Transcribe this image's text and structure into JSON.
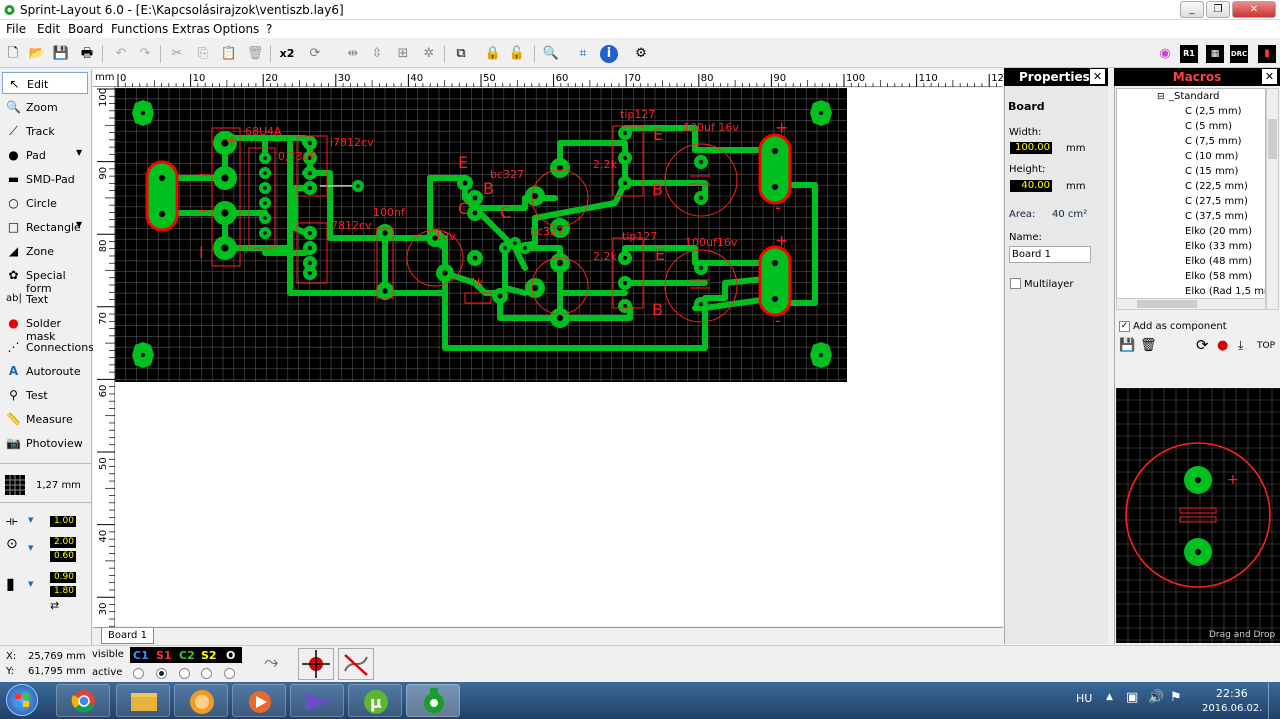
{
  "window": {
    "title": "Sprint-Layout 6.0 - [E:\\Kapcsolásirajzok\\ventiszb.lay6]",
    "buttons": [
      "_",
      "❐",
      "✕"
    ]
  },
  "menu": [
    "File",
    "Edit",
    "Board",
    "Functions",
    "Extras",
    "Options",
    "?"
  ],
  "toolbar": {
    "items": [
      "new-icon",
      "open-icon",
      "save-icon",
      "print-icon",
      "undo-icon",
      "redo-icon",
      "cut-icon",
      "copy-icon",
      "paste-icon",
      "delete-icon",
      "duplicate-icon",
      "rotate-icon",
      "mirror-h-icon",
      "mirror-v-icon",
      "align-icon",
      "group-icon",
      "lock-icon",
      "unlock-icon",
      "zoom-icon",
      "crop-icon",
      "info-icon",
      "gear-icon"
    ],
    "duplicate_label": "x2"
  },
  "tools": [
    {
      "label": "Edit",
      "icon": "arrow-icon"
    },
    {
      "label": "Zoom",
      "icon": "zoom-icon"
    },
    {
      "label": "Track",
      "icon": "track-icon"
    },
    {
      "label": "Pad",
      "icon": "pad-icon"
    },
    {
      "label": "SMD-Pad",
      "icon": "smd-pad-icon"
    },
    {
      "label": "Circle",
      "icon": "circle-icon"
    },
    {
      "label": "Rectangle",
      "icon": "rectangle-icon"
    },
    {
      "label": "Zone",
      "icon": "zone-icon"
    },
    {
      "label": "Special form",
      "icon": "special-form-icon"
    },
    {
      "label": "Text",
      "icon": "text-icon"
    },
    {
      "label": "Solder mask",
      "icon": "solder-mask-icon"
    },
    {
      "label": "Connections",
      "icon": "connections-icon"
    },
    {
      "label": "Autoroute",
      "icon": "autoroute-icon"
    },
    {
      "label": "Test",
      "icon": "test-icon"
    },
    {
      "label": "Measure",
      "icon": "measure-icon"
    },
    {
      "label": "Photoview",
      "icon": "photoview-icon"
    }
  ],
  "grid": "1,27 mm",
  "track_width": "1.00",
  "pad_outer": "2.00",
  "pad_inner": "0.60",
  "smd_w": "0.90",
  "smd_h": "1.80",
  "ruler": {
    "unit": "mm",
    "h_ticks": [
      "0",
      "10",
      "20",
      "30",
      "40",
      "50",
      "60",
      "70",
      "80",
      "90",
      "100",
      "110",
      "120"
    ],
    "v_ticks": [
      "100",
      "90",
      "80",
      "70",
      "60",
      "50",
      "40",
      "30"
    ]
  },
  "board_tab": "Board 1",
  "pcb_labels": [
    "68U4A",
    "0,33uF",
    "i7812cv",
    "i7812cv",
    "100nf",
    "bc327",
    "bc327",
    "tip127",
    "tip127",
    "100uf 16v",
    "100uf16v",
    "2,2k",
    "2,2k",
    "1k",
    "10v",
    "E",
    "B",
    "C",
    "E",
    "B",
    "E",
    "B",
    "C",
    "+",
    "+",
    "+",
    "-",
    "-",
    "I",
    "~",
    "~"
  ],
  "properties": {
    "header": "Properties",
    "section": "Board",
    "width_label": "Width:",
    "width_value": "100.00",
    "height_label": "Height:",
    "height_value": "40.00",
    "unit": "mm",
    "area_label": "Area:",
    "area_value": "40 cm²",
    "name_label": "Name:",
    "name_value": "Board 1",
    "multilayer_label": "Multilayer"
  },
  "macros": {
    "header": "Macros",
    "root": "_Standard",
    "items": [
      "C (2,5 mm)",
      "C (5 mm)",
      "C (7,5 mm)",
      "C (10 mm)",
      "C (15 mm)",
      "C (22,5 mm)",
      "C (27,5 mm)",
      "C (37,5 mm)",
      "Elko (20 mm)",
      "Elko (33 mm)",
      "Elko (48 mm)",
      "Elko (58 mm)",
      "Elko (Rad 1,5 mm"
    ],
    "add_as_component": "Add as component",
    "top_label": "TOP",
    "drag_drop": "Drag and Drop"
  },
  "status": {
    "x_label": "X:",
    "x_value": "25,769 mm",
    "y_label": "Y:",
    "y_value": "61,795 mm",
    "visible_label": "visible",
    "active_label": "active",
    "layers": [
      {
        "name": "C1",
        "color": "#3b8fff"
      },
      {
        "name": "S1",
        "color": "#ff3030"
      },
      {
        "name": "C2",
        "color": "#30d030"
      },
      {
        "name": "S2",
        "color": "#ffff00"
      },
      {
        "name": "O",
        "color": "#ffffff"
      }
    ]
  },
  "taskbar": {
    "lang": "HU",
    "time": "22:36",
    "date": "2016.06.02."
  },
  "colors": {
    "copper": "#00c020",
    "silk": "#ff2020",
    "board_bg": "#000000"
  }
}
